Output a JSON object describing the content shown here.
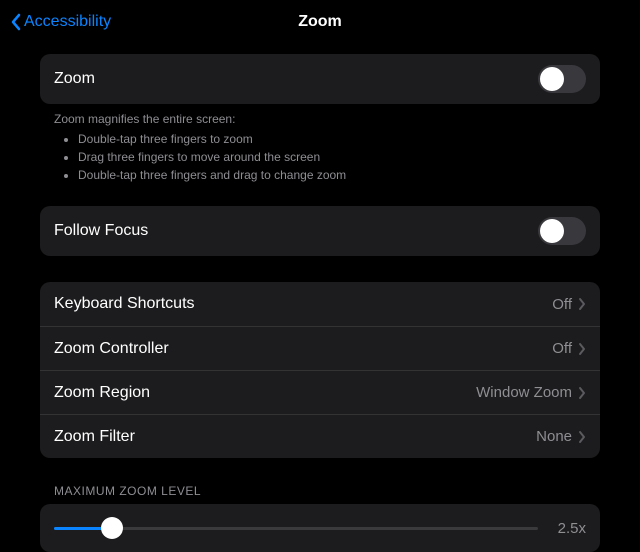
{
  "header": {
    "back_label": "Accessibility",
    "title": "Zoom"
  },
  "zoom_toggle": {
    "label": "Zoom",
    "on": false
  },
  "zoom_note": {
    "intro": "Zoom magnifies the entire screen:",
    "bullets": [
      "Double-tap three fingers to zoom",
      "Drag three fingers to move around the screen",
      "Double-tap three fingers and drag to change zoom"
    ]
  },
  "follow_focus": {
    "label": "Follow Focus",
    "on": false
  },
  "options": [
    {
      "label": "Keyboard Shortcuts",
      "value": "Off"
    },
    {
      "label": "Zoom Controller",
      "value": "Off"
    },
    {
      "label": "Zoom Region",
      "value": "Window Zoom"
    },
    {
      "label": "Zoom Filter",
      "value": "None"
    }
  ],
  "slider": {
    "header": "MAXIMUM ZOOM LEVEL",
    "value_label": "2.5x",
    "percent": 12
  }
}
